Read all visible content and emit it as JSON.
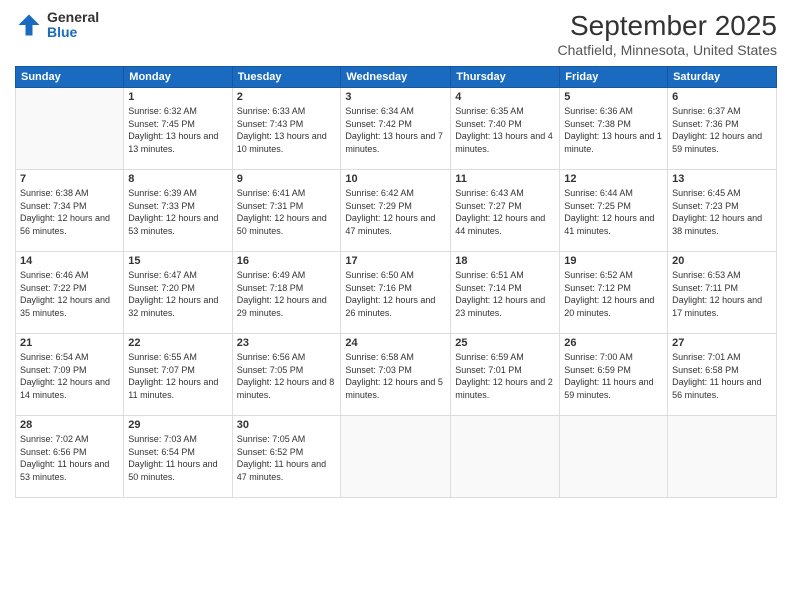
{
  "logo": {
    "general": "General",
    "blue": "Blue"
  },
  "header": {
    "month": "September 2025",
    "location": "Chatfield, Minnesota, United States"
  },
  "weekdays": [
    "Sunday",
    "Monday",
    "Tuesday",
    "Wednesday",
    "Thursday",
    "Friday",
    "Saturday"
  ],
  "weeks": [
    [
      {
        "day": "",
        "empty": true
      },
      {
        "day": "1",
        "sunrise": "6:32 AM",
        "sunset": "7:45 PM",
        "daylight": "13 hours and 13 minutes."
      },
      {
        "day": "2",
        "sunrise": "6:33 AM",
        "sunset": "7:43 PM",
        "daylight": "13 hours and 10 minutes."
      },
      {
        "day": "3",
        "sunrise": "6:34 AM",
        "sunset": "7:42 PM",
        "daylight": "13 hours and 7 minutes."
      },
      {
        "day": "4",
        "sunrise": "6:35 AM",
        "sunset": "7:40 PM",
        "daylight": "13 hours and 4 minutes."
      },
      {
        "day": "5",
        "sunrise": "6:36 AM",
        "sunset": "7:38 PM",
        "daylight": "13 hours and 1 minute."
      },
      {
        "day": "6",
        "sunrise": "6:37 AM",
        "sunset": "7:36 PM",
        "daylight": "12 hours and 59 minutes."
      }
    ],
    [
      {
        "day": "7",
        "sunrise": "6:38 AM",
        "sunset": "7:34 PM",
        "daylight": "12 hours and 56 minutes."
      },
      {
        "day": "8",
        "sunrise": "6:39 AM",
        "sunset": "7:33 PM",
        "daylight": "12 hours and 53 minutes."
      },
      {
        "day": "9",
        "sunrise": "6:41 AM",
        "sunset": "7:31 PM",
        "daylight": "12 hours and 50 minutes."
      },
      {
        "day": "10",
        "sunrise": "6:42 AM",
        "sunset": "7:29 PM",
        "daylight": "12 hours and 47 minutes."
      },
      {
        "day": "11",
        "sunrise": "6:43 AM",
        "sunset": "7:27 PM",
        "daylight": "12 hours and 44 minutes."
      },
      {
        "day": "12",
        "sunrise": "6:44 AM",
        "sunset": "7:25 PM",
        "daylight": "12 hours and 41 minutes."
      },
      {
        "day": "13",
        "sunrise": "6:45 AM",
        "sunset": "7:23 PM",
        "daylight": "12 hours and 38 minutes."
      }
    ],
    [
      {
        "day": "14",
        "sunrise": "6:46 AM",
        "sunset": "7:22 PM",
        "daylight": "12 hours and 35 minutes."
      },
      {
        "day": "15",
        "sunrise": "6:47 AM",
        "sunset": "7:20 PM",
        "daylight": "12 hours and 32 minutes."
      },
      {
        "day": "16",
        "sunrise": "6:49 AM",
        "sunset": "7:18 PM",
        "daylight": "12 hours and 29 minutes."
      },
      {
        "day": "17",
        "sunrise": "6:50 AM",
        "sunset": "7:16 PM",
        "daylight": "12 hours and 26 minutes."
      },
      {
        "day": "18",
        "sunrise": "6:51 AM",
        "sunset": "7:14 PM",
        "daylight": "12 hours and 23 minutes."
      },
      {
        "day": "19",
        "sunrise": "6:52 AM",
        "sunset": "7:12 PM",
        "daylight": "12 hours and 20 minutes."
      },
      {
        "day": "20",
        "sunrise": "6:53 AM",
        "sunset": "7:11 PM",
        "daylight": "12 hours and 17 minutes."
      }
    ],
    [
      {
        "day": "21",
        "sunrise": "6:54 AM",
        "sunset": "7:09 PM",
        "daylight": "12 hours and 14 minutes."
      },
      {
        "day": "22",
        "sunrise": "6:55 AM",
        "sunset": "7:07 PM",
        "daylight": "12 hours and 11 minutes."
      },
      {
        "day": "23",
        "sunrise": "6:56 AM",
        "sunset": "7:05 PM",
        "daylight": "12 hours and 8 minutes."
      },
      {
        "day": "24",
        "sunrise": "6:58 AM",
        "sunset": "7:03 PM",
        "daylight": "12 hours and 5 minutes."
      },
      {
        "day": "25",
        "sunrise": "6:59 AM",
        "sunset": "7:01 PM",
        "daylight": "12 hours and 2 minutes."
      },
      {
        "day": "26",
        "sunrise": "7:00 AM",
        "sunset": "6:59 PM",
        "daylight": "11 hours and 59 minutes."
      },
      {
        "day": "27",
        "sunrise": "7:01 AM",
        "sunset": "6:58 PM",
        "daylight": "11 hours and 56 minutes."
      }
    ],
    [
      {
        "day": "28",
        "sunrise": "7:02 AM",
        "sunset": "6:56 PM",
        "daylight": "11 hours and 53 minutes."
      },
      {
        "day": "29",
        "sunrise": "7:03 AM",
        "sunset": "6:54 PM",
        "daylight": "11 hours and 50 minutes."
      },
      {
        "day": "30",
        "sunrise": "7:05 AM",
        "sunset": "6:52 PM",
        "daylight": "11 hours and 47 minutes."
      },
      {
        "day": "",
        "empty": true
      },
      {
        "day": "",
        "empty": true
      },
      {
        "day": "",
        "empty": true
      },
      {
        "day": "",
        "empty": true
      }
    ]
  ]
}
